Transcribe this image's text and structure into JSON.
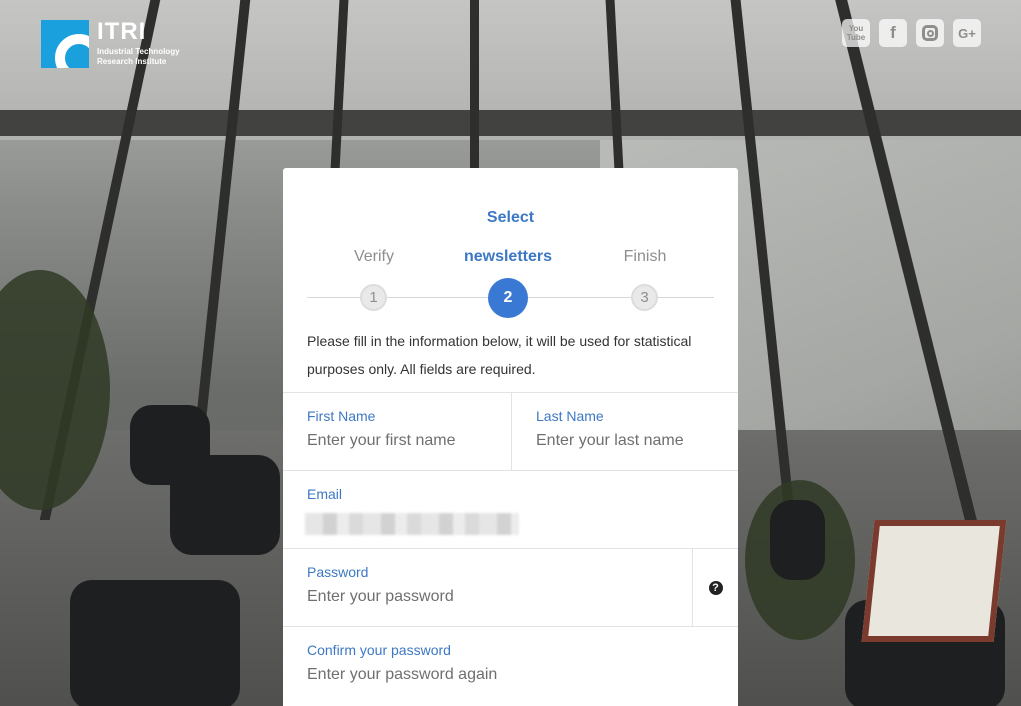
{
  "brand": {
    "name": "ITRI",
    "subtitle_line1": "Industrial Technology",
    "subtitle_line2": "Research Institute"
  },
  "social": [
    {
      "icon": "youtube-icon",
      "label": "You Tube"
    },
    {
      "icon": "facebook-icon",
      "label": "f"
    },
    {
      "icon": "instagram-icon",
      "label": ""
    },
    {
      "icon": "google-plus-icon",
      "label": "G+"
    }
  ],
  "steps": {
    "heading": "Select",
    "items": [
      {
        "label": "Verify",
        "number": "1",
        "active": false
      },
      {
        "label": "newsletters",
        "number": "2",
        "active": true
      },
      {
        "label": "Finish",
        "number": "3",
        "active": false
      }
    ]
  },
  "intro": "Please fill in the information below, it will be used for statistical purposes only. All fields are required.",
  "form": {
    "first_name": {
      "label": "First Name",
      "placeholder": "Enter your first name"
    },
    "last_name": {
      "label": "Last Name",
      "placeholder": "Enter your last name"
    },
    "email": {
      "label": "Email",
      "value_obscured": true
    },
    "password": {
      "label": "Password",
      "placeholder": "Enter your password",
      "help_icon": "question-circle-icon"
    },
    "confirm_password": {
      "label": "Confirm your password",
      "placeholder": "Enter your password again"
    }
  },
  "colors": {
    "accent": "#3d78c4",
    "active_step": "#3a79d3",
    "logo_blue": "#1aa0dc"
  }
}
